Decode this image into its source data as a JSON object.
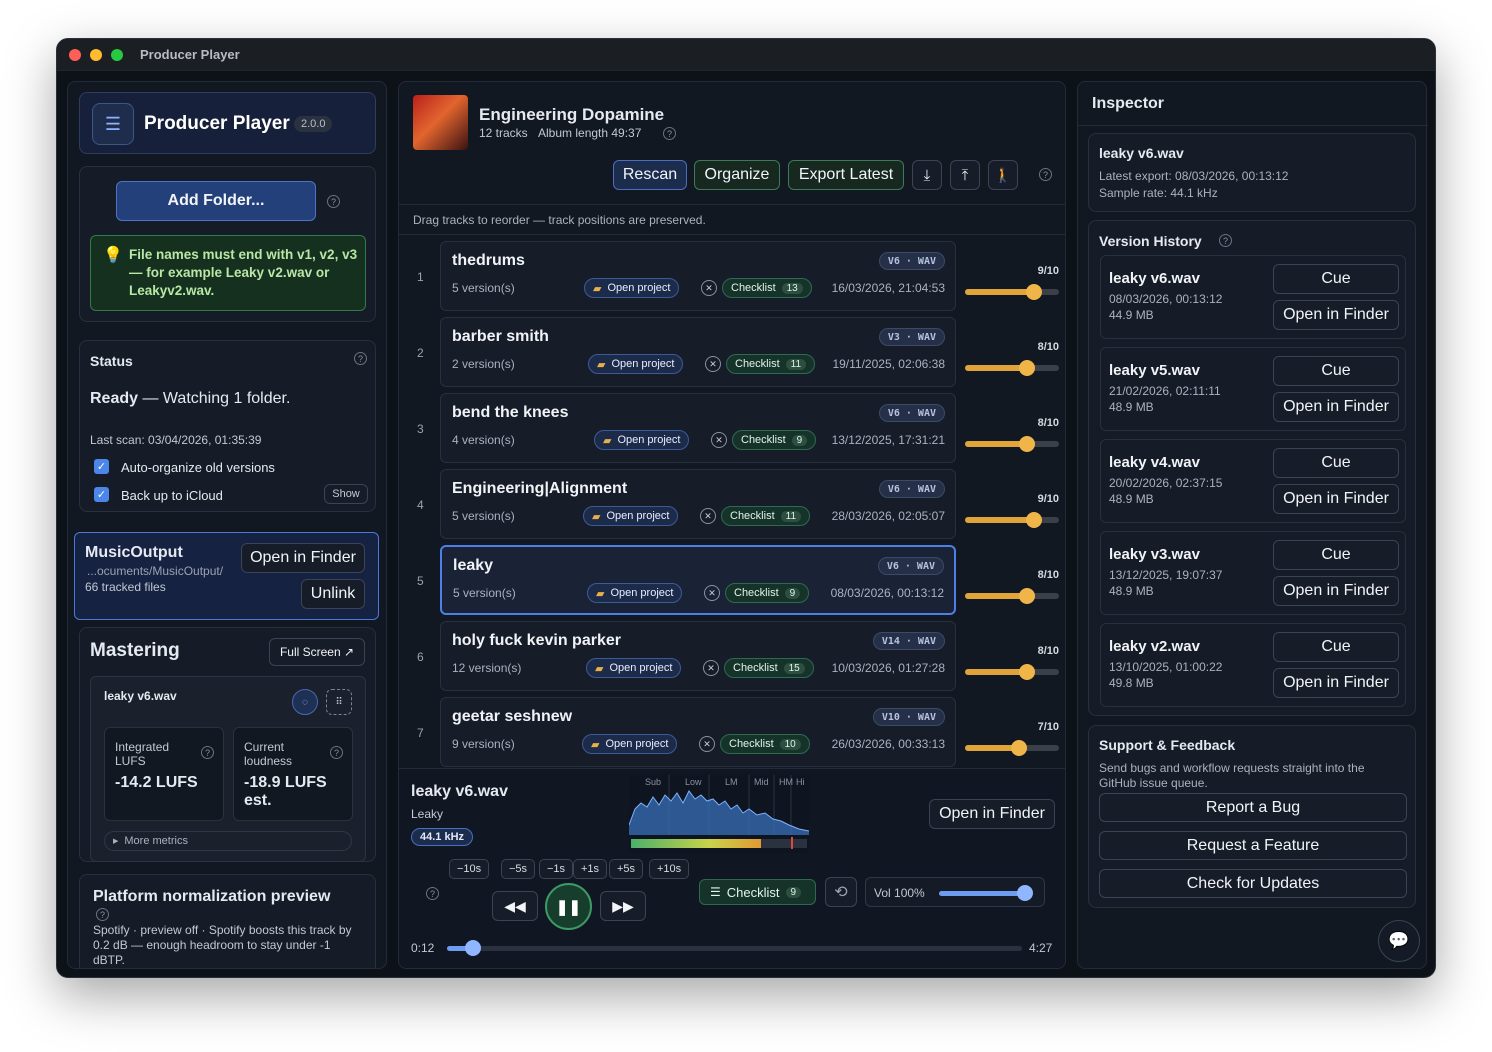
{
  "window": {
    "title": "Producer Player"
  },
  "sidebar": {
    "app_name": "Producer Player",
    "version": "2.0.0",
    "add_folder": "Add Folder...",
    "hint": "File names must end with v1, v2, v3 — for example Leaky v2.wav or Leakyv2.wav.",
    "status": {
      "title": "Status",
      "state": "Ready",
      "watching": " — Watching 1 folder.",
      "last_scan": "Last scan: 03/04/2026, 01:35:39",
      "auto_organize": "Auto-organize old versions",
      "icloud": "Back up to iCloud",
      "show": "Show"
    },
    "folder": {
      "name": "MusicOutput",
      "path": "...ocuments/MusicOutput/",
      "tracked": "66 tracked files",
      "open_finder": "Open in Finder",
      "unlink": "Unlink"
    },
    "mastering": {
      "title": "Mastering",
      "full_screen": "Full Screen ↗",
      "file": "leaky v6.wav",
      "integrated_label": "Integrated LUFS",
      "integrated_value": "-14.2 LUFS",
      "current_label": "Current loudness",
      "current_value": "-18.9 LUFS est.",
      "more_metrics": "More metrics"
    },
    "platform": {
      "title": "Platform normalization preview",
      "text": "Spotify · preview off · Spotify boosts this track by 0.2 dB — enough headroom to stay under -1 dBTP."
    }
  },
  "album": {
    "title": "Engineering Dopamine",
    "tracks": "12 tracks",
    "length": "Album length 49:37",
    "buttons": {
      "rescan": "Rescan",
      "organize": "Organize",
      "export": "Export Latest"
    },
    "drag_hint": "Drag tracks to reorder — track positions are preserved."
  },
  "tracks": [
    {
      "num": "1",
      "name": "thedrums",
      "versions": "5 version(s)",
      "badge": "V6 · WAV",
      "project": "Open project",
      "checklist": "Checklist",
      "checks": "13",
      "date": "16/03/2026, 21:04:53",
      "rating": "9/10",
      "rating_value": 9
    },
    {
      "num": "2",
      "name": "barber smith",
      "versions": "2 version(s)",
      "badge": "V3 · WAV",
      "project": "Open project",
      "checklist": "Checklist",
      "checks": "11",
      "date": "19/11/2025, 02:06:38",
      "rating": "8/10",
      "rating_value": 8
    },
    {
      "num": "3",
      "name": "bend the knees",
      "versions": "4 version(s)",
      "badge": "V6 · WAV",
      "project": "Open project",
      "checklist": "Checklist",
      "checks": "9",
      "date": "13/12/2025, 17:31:21",
      "rating": "8/10",
      "rating_value": 8
    },
    {
      "num": "4",
      "name": "Engineering|Alignment",
      "versions": "5 version(s)",
      "badge": "V6 · WAV",
      "project": "Open project",
      "checklist": "Checklist",
      "checks": "11",
      "date": "28/03/2026, 02:05:07",
      "rating": "9/10",
      "rating_value": 9
    },
    {
      "num": "5",
      "name": "leaky",
      "versions": "5 version(s)",
      "badge": "V6 · WAV",
      "project": "Open project",
      "checklist": "Checklist",
      "checks": "9",
      "date": "08/03/2026, 00:13:12",
      "rating": "8/10",
      "rating_value": 8
    },
    {
      "num": "6",
      "name": "holy fuck kevin parker",
      "versions": "12 version(s)",
      "badge": "V14 · WAV",
      "project": "Open project",
      "checklist": "Checklist",
      "checks": "15",
      "date": "10/03/2026, 01:27:28",
      "rating": "8/10",
      "rating_value": 8
    },
    {
      "num": "7",
      "name": "geetar seshnew",
      "versions": "9 version(s)",
      "badge": "V10 · WAV",
      "project": "Open project",
      "checklist": "Checklist",
      "checks": "10",
      "date": "26/03/2026, 00:33:13",
      "rating": "7/10",
      "rating_value": 7
    }
  ],
  "player": {
    "file": "leaky v6.wav",
    "track": "Leaky",
    "rate": "44.1 kHz",
    "bands": [
      "Sub",
      "Low",
      "LM",
      "Mid",
      "HM",
      "Hi"
    ],
    "open_finder": "Open in Finder",
    "seek": [
      "−10s",
      "−5s",
      "−1s",
      "+1s",
      "+5s",
      "+10s"
    ],
    "checklist": "Checklist",
    "checks": "9",
    "volume_label": "Vol 100%",
    "volume": 1.0,
    "elapsed": "0:12",
    "total": "4:27",
    "progress": 0.045
  },
  "inspector": {
    "title": "Inspector",
    "file": "leaky v6.wav",
    "latest_export": "Latest export: 08/03/2026, 00:13:12",
    "sample_rate": "Sample rate: 44.1 kHz",
    "history_title": "Version History",
    "versions": [
      {
        "name": "leaky v6.wav",
        "date": "08/03/2026, 00:13:12",
        "size": "44.9 MB",
        "cue": "Cue",
        "open": "Open in Finder"
      },
      {
        "name": "leaky v5.wav",
        "date": "21/02/2026, 02:11:11",
        "size": "48.9 MB",
        "cue": "Cue",
        "open": "Open in Finder"
      },
      {
        "name": "leaky v4.wav",
        "date": "20/02/2026, 02:37:15",
        "size": "48.9 MB",
        "cue": "Cue",
        "open": "Open in Finder"
      },
      {
        "name": "leaky v3.wav",
        "date": "13/12/2025, 19:07:37",
        "size": "48.9 MB",
        "cue": "Cue",
        "open": "Open in Finder"
      },
      {
        "name": "leaky v2.wav",
        "date": "13/10/2025, 01:00:22",
        "size": "49.8 MB",
        "cue": "Cue",
        "open": "Open in Finder"
      }
    ],
    "support": {
      "title": "Support & Feedback",
      "text": "Send bugs and workflow requests straight into the GitHub issue queue.",
      "report": "Report a Bug",
      "request": "Request a Feature",
      "updates": "Check for Updates"
    }
  },
  "colors": {
    "accent": "#4e7fe6",
    "rating": "#f0b548",
    "success": "#2e6a51"
  }
}
